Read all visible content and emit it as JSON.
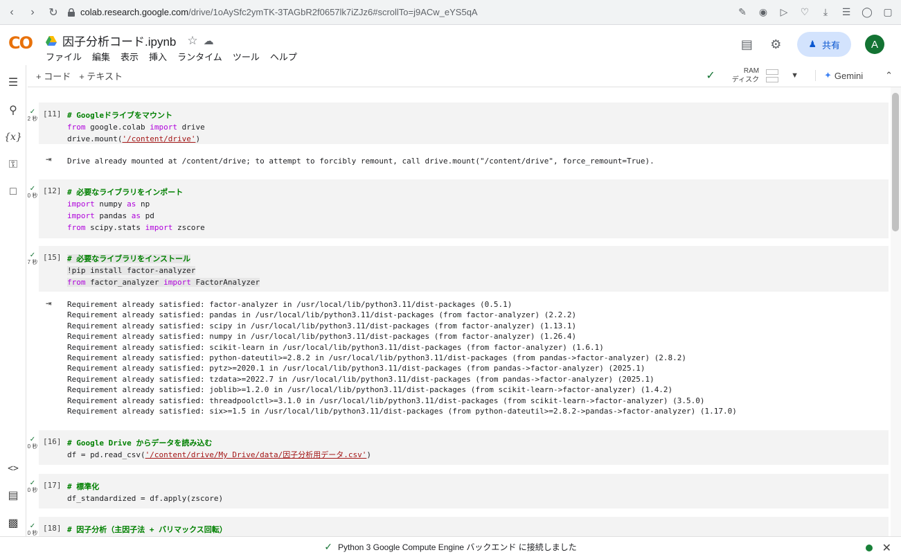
{
  "browser": {
    "url_host": "colab.research.google.com",
    "url_path": "/drive/1oAySfc2ymTK-3TAGbR2f0657lk7iZJz6#scrollTo=j9ACw_eYS5qA"
  },
  "header": {
    "logo": "CO",
    "title": "因子分析コード.ipynb",
    "menu": [
      "ファイル",
      "編集",
      "表示",
      "挿入",
      "ランタイム",
      "ツール",
      "ヘルプ"
    ],
    "share_label": "共有",
    "avatar_letter": "A"
  },
  "toolbar": {
    "add_code": "+ コード",
    "add_text": "+ テキスト",
    "ram_label": "RAM",
    "disk_label": "ディスク",
    "gemini_label": "Gemini"
  },
  "cells": [
    {
      "count": "[11]",
      "time": "2 秒"
    },
    {
      "count": "[12]",
      "time": "0 秒"
    },
    {
      "count": "[15]",
      "time": "7 秒"
    },
    {
      "count": "[16]",
      "time": "0 秒"
    },
    {
      "count": "[17]",
      "time": "0 秒"
    },
    {
      "count": "[18]",
      "time": "0 秒"
    }
  ],
  "outputs": {
    "drive_mount": "Drive already mounted at /content/drive; to attempt to forcibly remount, call drive.mount(\"/content/drive\", force_remount=True).",
    "pip_lines": [
      "Requirement already satisfied: factor-analyzer in /usr/local/lib/python3.11/dist-packages (0.5.1)",
      "Requirement already satisfied: pandas in /usr/local/lib/python3.11/dist-packages (from factor-analyzer) (2.2.2)",
      "Requirement already satisfied: scipy in /usr/local/lib/python3.11/dist-packages (from factor-analyzer) (1.13.1)",
      "Requirement already satisfied: numpy in /usr/local/lib/python3.11/dist-packages (from factor-analyzer) (1.26.4)",
      "Requirement already satisfied: scikit-learn in /usr/local/lib/python3.11/dist-packages (from factor-analyzer) (1.6.1)",
      "Requirement already satisfied: python-dateutil>=2.8.2 in /usr/local/lib/python3.11/dist-packages (from pandas->factor-analyzer) (2.8.2)",
      "Requirement already satisfied: pytz>=2020.1 in /usr/local/lib/python3.11/dist-packages (from pandas->factor-analyzer) (2025.1)",
      "Requirement already satisfied: tzdata>=2022.7 in /usr/local/lib/python3.11/dist-packages (from pandas->factor-analyzer) (2025.1)",
      "Requirement already satisfied: joblib>=1.2.0 in /usr/local/lib/python3.11/dist-packages (from scikit-learn->factor-analyzer) (1.4.2)",
      "Requirement already satisfied: threadpoolctl>=3.1.0 in /usr/local/lib/python3.11/dist-packages (from scikit-learn->factor-analyzer) (3.5.0)",
      "Requirement already satisfied: six>=1.5 in /usr/local/lib/python3.11/dist-packages (from python-dateutil>=2.8.2->pandas->factor-analyzer) (1.17.0)"
    ]
  },
  "code": {
    "c11_l1": "# Googleドライブをマウント",
    "c11_l2a": "from",
    "c11_l2b": " google.colab ",
    "c11_l2c": "import",
    "c11_l2d": " drive",
    "c11_l3a": "drive.mount(",
    "c11_l3b": "'/content/drive'",
    "c11_l3c": ")",
    "c12_l1": "# 必要なライブラリをインポート",
    "c12_l2a": "import",
    "c12_l2b": " numpy ",
    "c12_l2c": "as",
    "c12_l2d": " np",
    "c12_l3a": "import",
    "c12_l3b": " pandas ",
    "c12_l3c": "as",
    "c12_l3d": " pd",
    "c12_l4a": "from",
    "c12_l4b": " scipy.stats ",
    "c12_l4c": "import",
    "c12_l4d": " zscore",
    "c15_l1": "# 必要なライブラリをインストール",
    "c15_l2": "!pip install factor-analyzer",
    "c15_l3a": "from",
    "c15_l3b": " factor_analyzer ",
    "c15_l3c": "import",
    "c15_l3d": " FactorAnalyzer",
    "c16_l1": "# Google Drive からデータを読み込む",
    "c16_l2a": "df = pd.read_csv(",
    "c16_l2b": "'/content/drive/My Drive/data/因子分析用データ.csv'",
    "c16_l2c": ")",
    "c17_l1": "# 標準化",
    "c17_l2": "df_standardized = df.apply(zscore)",
    "c18_l1": "# 因子分析（主因子法 + バリマックス回転）"
  },
  "status": {
    "message": "Python 3 Google Compute Engine バックエンド に接続しました"
  },
  "colors": {
    "accent": "#0b57d0",
    "ok_green": "#137333",
    "comment": "#008000",
    "keyword": "#af00db",
    "string": "#a31515"
  }
}
